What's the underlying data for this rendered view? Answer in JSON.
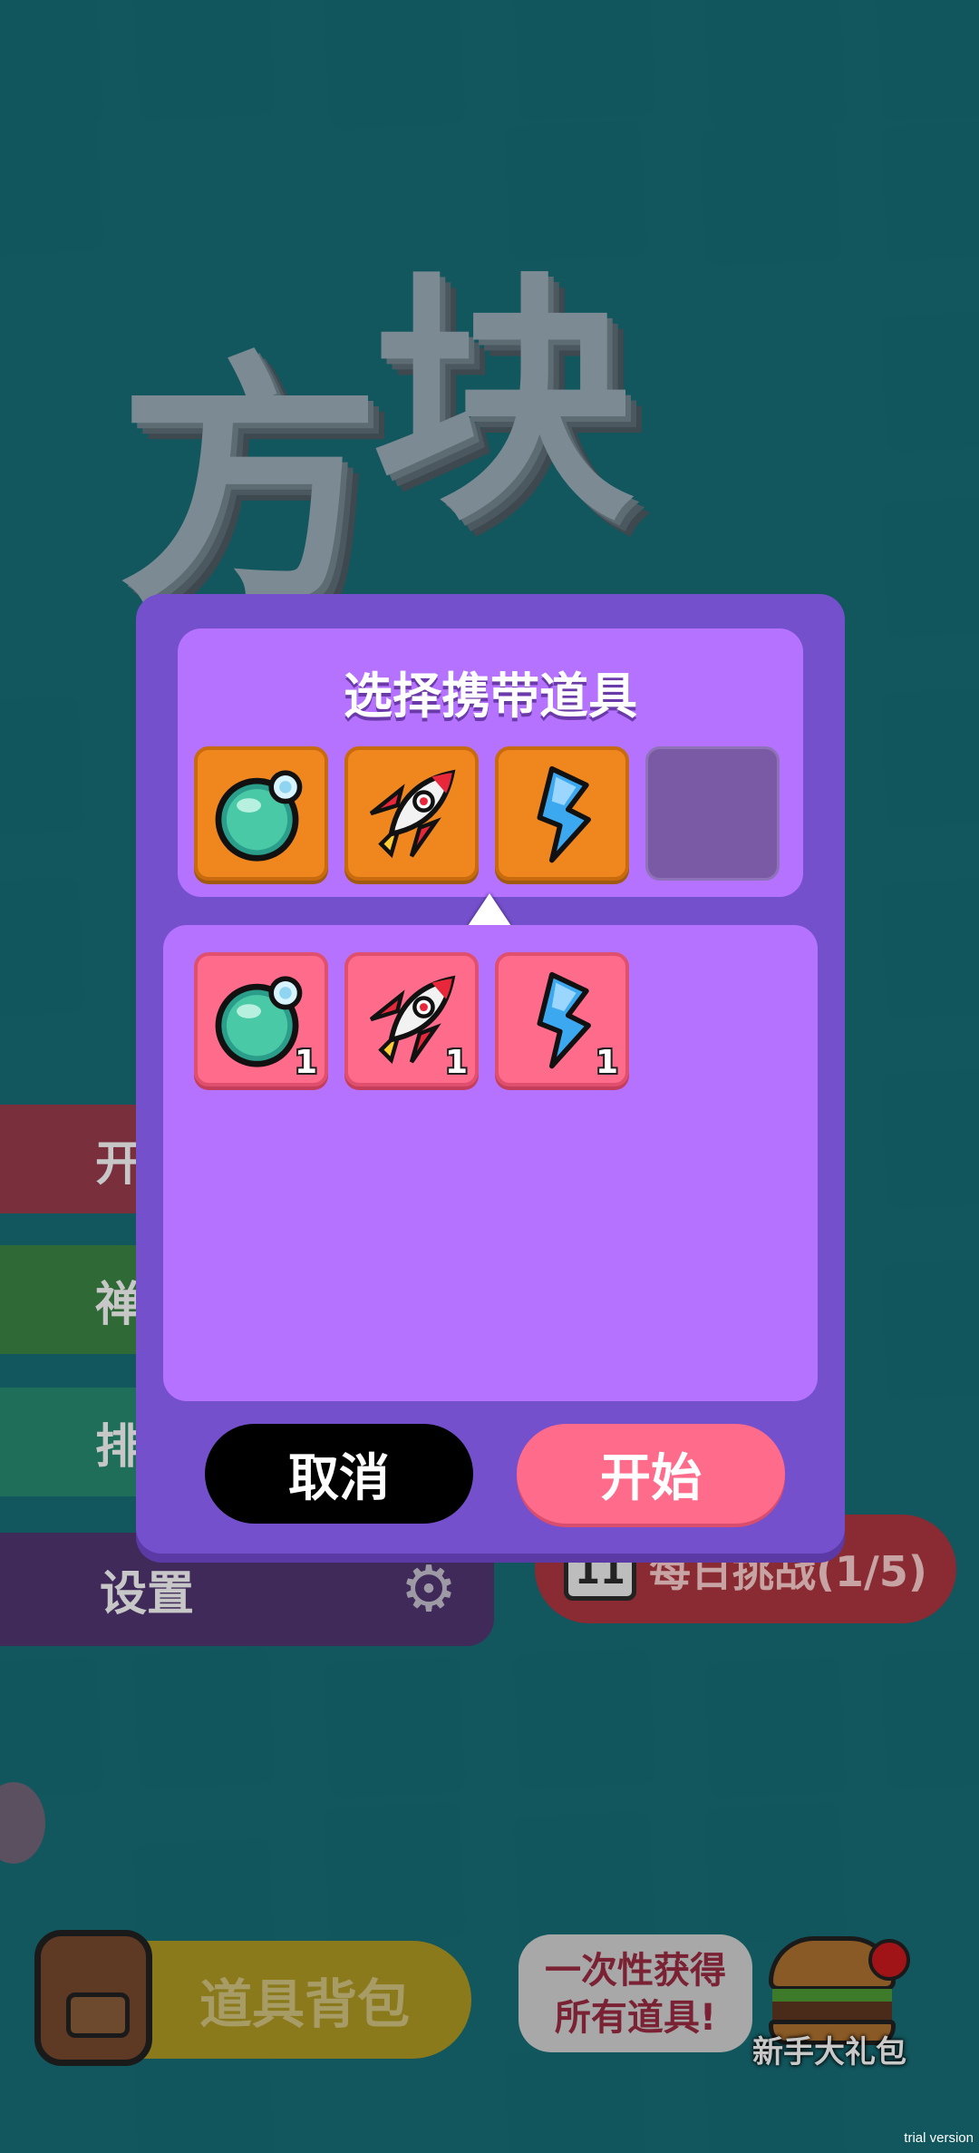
{
  "modal": {
    "title": "选择携带道具",
    "selected_slots": [
      {
        "icon": "bubble-potion-icon"
      },
      {
        "icon": "rocket-icon"
      },
      {
        "icon": "lightning-icon"
      },
      {
        "icon": "empty-slot"
      }
    ],
    "inventory": [
      {
        "icon": "bubble-potion-icon",
        "count": "1"
      },
      {
        "icon": "rocket-icon",
        "count": "1"
      },
      {
        "icon": "lightning-icon",
        "count": "1"
      }
    ],
    "cancel_label": "取消",
    "start_label": "开始"
  },
  "background": {
    "title_chars": [
      "方",
      "块"
    ],
    "menu": {
      "start": "开",
      "zen": "禅",
      "rank": "排",
      "settings": "设置"
    },
    "daily": {
      "day": "11",
      "label": "每日挑战(1/5)"
    },
    "bag_label": "道具背包",
    "promo_line1": "一次性获得",
    "promo_line2": "所有道具!",
    "gift_label": "新手大礼包",
    "watermark": "trial version"
  },
  "colors": {
    "background": "#136a70",
    "modal": "#7550cc",
    "panel": "#b572ff",
    "selected_slot": "#f0871e",
    "inventory_slot": "#ff6b8a",
    "start_button": "#ff6b8a",
    "cancel_button": "#000000"
  }
}
